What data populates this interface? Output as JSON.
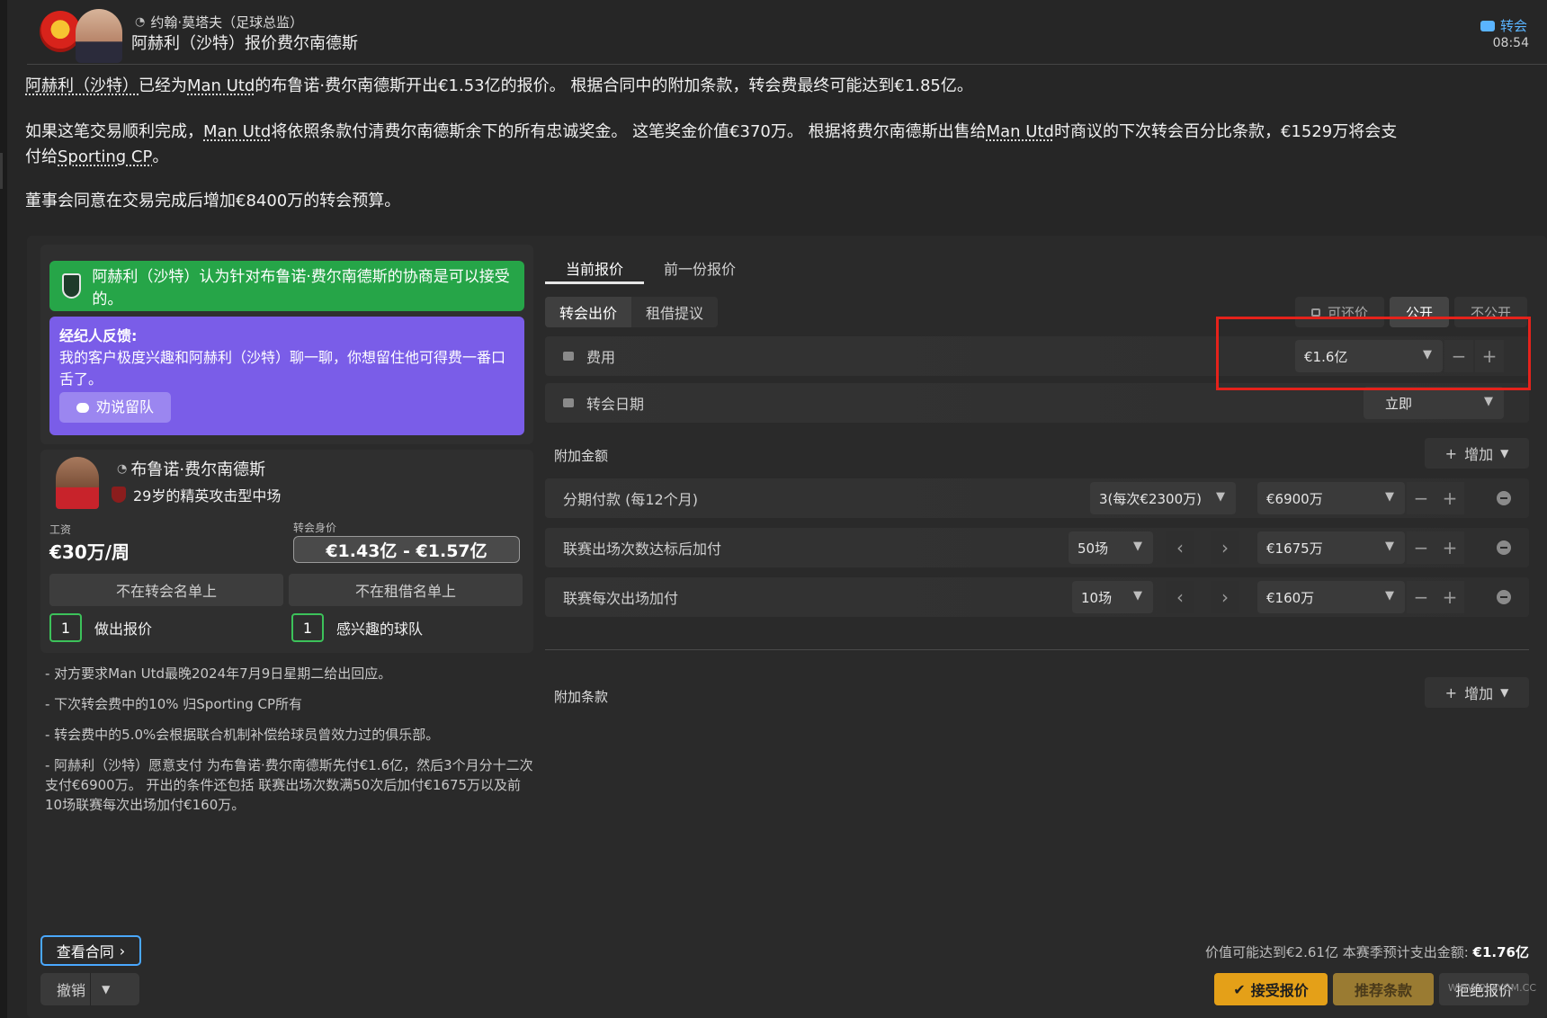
{
  "header": {
    "sender": "约翰·莫塔夫（足球总监）",
    "subject": "阿赫利（沙特）报价费尔南德斯",
    "tag": "转会",
    "time": "08:54",
    "crest_icon": "man-utd-crest-icon",
    "colors": {
      "tag": "#5ab4ff"
    }
  },
  "message": {
    "p1_pre": "阿赫利（沙特）",
    "p1_mid1": "已经为",
    "p1_club": "Man Utd",
    "p1_mid2": "的布鲁诺·费尔南德斯开出€1.53亿的报价。 根据合同中的附加条款，转会费最终可能达到€1.85亿。",
    "p2_a": "如果这笔交易顺利完成，",
    "p2_club": "Man Utd",
    "p2_b": "将依照条款付清费尔南德斯余下的所有忠诚奖金。 这笔奖金价值€370万。 根据将费尔南德斯出售给",
    "p2_club2": "Man Utd",
    "p2_c": "时商议的下次转会百分比条款，€1529万将会支",
    "p2_d": "付给",
    "p2_club3": "Sporting CP",
    "p2_e": "。",
    "p3": "董事会同意在交易完成后增加€8400万的转会预算。"
  },
  "status": {
    "text": "阿赫利（沙特）认为针对布鲁诺·费尔南德斯的协商是可以接受的。",
    "color": "#26a548"
  },
  "agent": {
    "title": "经纪人反馈:",
    "text": "我的客户极度兴趣和阿赫利（沙特）聊一聊，你想留住他可得费一番口舌了。",
    "button": "劝说留队",
    "color": "#7a5de8"
  },
  "player": {
    "name": "布鲁诺·费尔南德斯",
    "desc": "29岁的精英攻击型中场",
    "wage_label": "工资",
    "wage": "€30万/周",
    "value_label": "转会身价",
    "value": "€1.43亿 - €1.57亿",
    "transfer_list": "不在转会名单上",
    "loan_list": "不在租借名单上",
    "offers_count": "1",
    "offers_label": "做出报价",
    "interested_count": "1",
    "interested_label": "感兴趣的球队"
  },
  "notes": [
    "- 对方要求Man Utd最晚2024年7月9日星期二给出回应。",
    "- 下次转会费中的10% 归Sporting CP所有",
    "- 转会费中的5.0%会根据联合机制补偿给球员曾效力过的俱乐部。",
    "- 阿赫利（沙特）愿意支付 为布鲁诺·费尔南德斯先付€1.6亿，然后3个月分十二次支付€6900万。 开出的条件还包括 联赛出场次数满50次后加付€1675万以及前10场联赛每次出场加付€160万。"
  ],
  "tabs": {
    "current": "当前报价",
    "previous": "前一份报价"
  },
  "offer_type": {
    "transfer": "转会出价",
    "loan": "租借提议"
  },
  "visibility": {
    "negotiable": "可还价",
    "public": "公开",
    "private": "不公开"
  },
  "fee": {
    "label": "费用",
    "value": "€1.6亿"
  },
  "date": {
    "label": "转会日期",
    "value": "立即"
  },
  "addons": {
    "title": "附加金额",
    "add": "增加",
    "rows": [
      {
        "label": "分期付款 (每12个月)",
        "option": "3(每次€2300万)",
        "amount": "€6900万"
      },
      {
        "label": "联赛出场次数达标后加付",
        "option": "50场",
        "amount": "€1675万"
      },
      {
        "label": "联赛每次出场加付",
        "option": "10场",
        "amount": "€160万"
      }
    ]
  },
  "clauses": {
    "title": "附加条款",
    "add": "增加"
  },
  "footer": {
    "view_contract": "查看合同",
    "undo": "撤销",
    "summary_prefix": "价值可能达到€2.61亿  本赛季预计支出金额: ",
    "summary_value": "€1.76亿",
    "accept": "接受报价",
    "recommend": "推荐条款",
    "reject": "拒绝报价",
    "watermark": "WWW.PLAYGM.CC",
    "colors": {
      "accept": "#e4a018",
      "contract_border": "#4aa8ff",
      "highlight": "#e5221b"
    }
  }
}
